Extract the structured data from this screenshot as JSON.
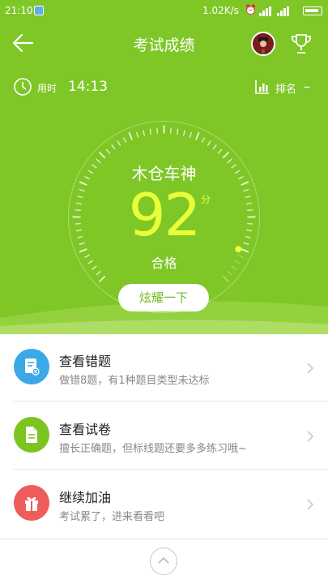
{
  "status_bar": {
    "time": "21:10",
    "net_speed": "1.02K/s",
    "alarm_icon": "alarm-icon",
    "signal_icon": "signal-icon",
    "battery_icon": "battery-icon"
  },
  "nav": {
    "title": "考试成绩",
    "back_icon": "back-arrow-icon",
    "trophy_icon": "trophy-icon"
  },
  "stats": {
    "time_label": "用时",
    "time_value": "14:13",
    "rank_label": "排名",
    "rank_value": "–"
  },
  "result": {
    "nickname": "木仓车神",
    "score": "92",
    "score_unit": "分",
    "status": "合格",
    "score_fraction": 0.92,
    "share_button": "炫耀一下"
  },
  "menu": [
    {
      "title": "查看错题",
      "subtitle": "做错8题，有1种题目类型未达标",
      "icon": "wrong-answers-icon",
      "color": "#3ba8e8"
    },
    {
      "title": "查看试卷",
      "subtitle": "擅长正确题，但标线题还要多多练习哦~",
      "icon": "exam-paper-icon",
      "color": "#7cc41f"
    },
    {
      "title": "继续加油",
      "subtitle": "考试累了，进来看看吧",
      "icon": "gift-icon",
      "color": "#ef5c5c"
    }
  ],
  "colors": {
    "hero_bg": "#7fc727",
    "score": "#e8ff3a",
    "accent_green": "#6fbb1f"
  }
}
